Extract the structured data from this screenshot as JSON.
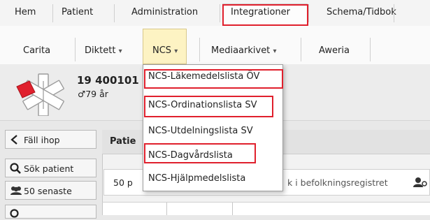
{
  "menubar": {
    "items": [
      "Hem",
      "Patient",
      "Administration",
      "Integrationer",
      "Schema/Tidbok"
    ]
  },
  "toolbar": {
    "items": [
      "Carita",
      "Diktett",
      "NCS",
      "Mediaarkivet",
      "Aweria"
    ],
    "dropdown_caret": "▾"
  },
  "patient": {
    "id": "19 400101",
    "age": "79 år",
    "sex_symbol": "♂",
    "icon": "medical-star-icon"
  },
  "ncs_menu": {
    "items": [
      "NCS-Läkemedelslista ÖV",
      "NCS-Ordinationslista SV",
      "NCS-Utdelningslista SV",
      "NCS-Dagvårdslista",
      "NCS-Hjälpmedelslista"
    ]
  },
  "left_nav": {
    "collapse": "Fäll ihop",
    "search_patient": "Sök patient",
    "recent": "50 senaste"
  },
  "main": {
    "tab_label": "Patie",
    "search_prefix": "50 p",
    "search_text": "k i befolkningsregistret"
  },
  "colors": {
    "highlight": "#e0202d",
    "active_tool": "#fdf3c3",
    "icon_red": "#e0202d"
  }
}
